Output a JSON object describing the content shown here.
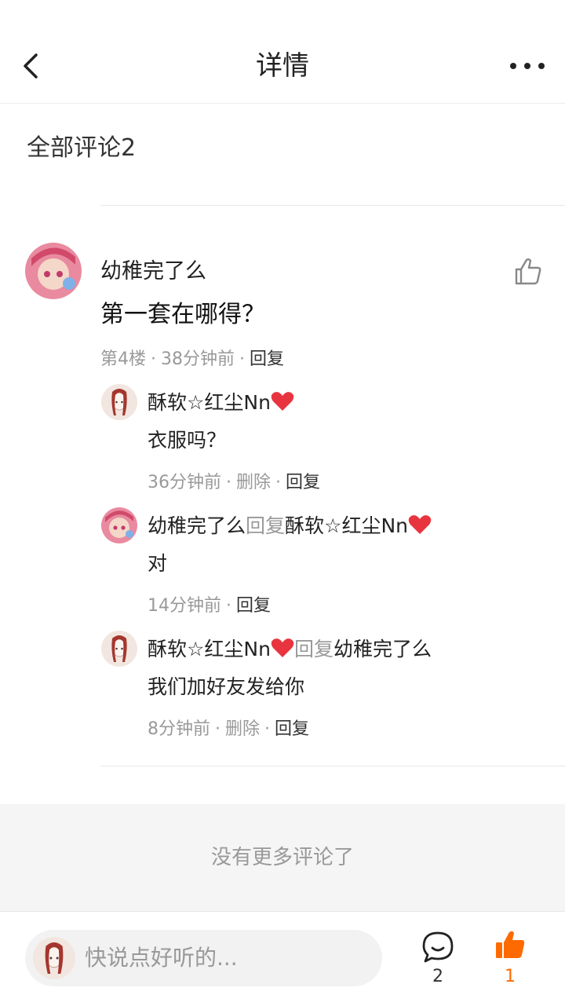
{
  "nav": {
    "title": "详情"
  },
  "section_title": "全部评论2",
  "comment": {
    "user": "幼稚完了么",
    "text": "第一套在哪得？",
    "floor": "第4楼",
    "time": "38分钟前",
    "reply": "回复"
  },
  "replies": [
    {
      "user": "酥软☆红尘Nn",
      "reply_word": "",
      "target": "",
      "text": "衣服吗？",
      "time": "36分钟前",
      "delete": "删除",
      "reply": "回复"
    },
    {
      "user": "幼稚完了么",
      "reply_word": "回复",
      "target": "酥软☆红尘Nn",
      "text": "对",
      "time": "14分钟前",
      "delete": "",
      "reply": "回复"
    },
    {
      "user": "酥软☆红尘Nn",
      "reply_word": "回复",
      "target": "幼稚完了么",
      "text": "我们加好友发给你",
      "time": "8分钟前",
      "delete": "删除",
      "reply": "回复"
    }
  ],
  "footer": {
    "no_more": "没有更多评论了"
  },
  "bottom": {
    "placeholder": "快说点好听的...",
    "comment_count": "2",
    "like_count": "1"
  },
  "colors": {
    "accent": "#ff6a00",
    "meta": "#999999",
    "band": "#f5f5f5"
  }
}
